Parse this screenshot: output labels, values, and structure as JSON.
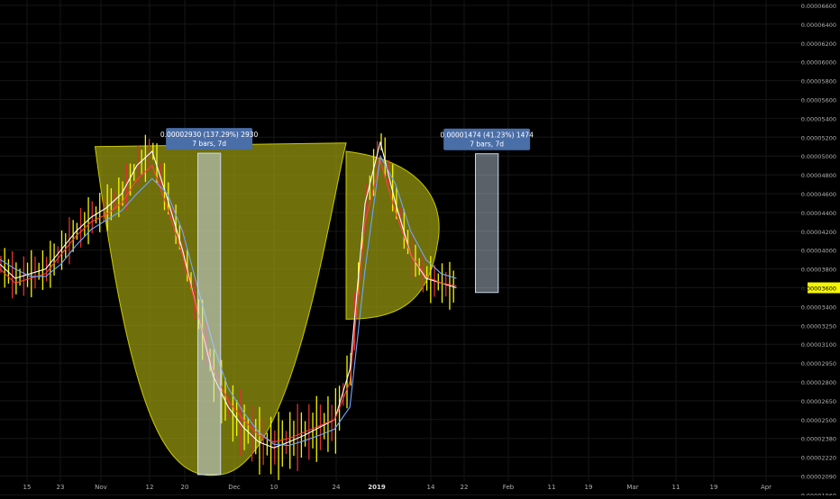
{
  "chart_data": {
    "type": "line",
    "price_axis": {
      "ticks": [
        "0.00006600",
        "0.00006400",
        "0.00006200",
        "0.00006000",
        "0.00005800",
        "0.00005600",
        "0.00005400",
        "0.00005200",
        "0.00005000",
        "0.00004800",
        "0.00004600",
        "0.00004400",
        "0.00004200",
        "0.00004000",
        "0.00003800",
        "0.00003600",
        "0.00003400",
        "0.00003250",
        "0.00003100",
        "0.00002950",
        "0.00002800",
        "0.00002650",
        "0.00002500",
        "0.00002380",
        "0.00002220",
        "0.00002090",
        "0.00001960"
      ],
      "current_price_label": "0.00003600",
      "current_price_color": "#f5f500"
    },
    "time_axis": {
      "ticks": [
        "15",
        "23",
        "Nov",
        "12",
        "20",
        "Dec",
        "10",
        "24",
        "2019",
        "14",
        "22",
        "Feb",
        "11",
        "19",
        "Mar",
        "11",
        "19",
        "Apr"
      ],
      "bold": [
        "2019"
      ]
    },
    "series": [
      {
        "name": "",
        "color": "#ffffff",
        "x": [
          0,
          4,
          8,
          12,
          16,
          20,
          24,
          28,
          32,
          36,
          40,
          44,
          48,
          52,
          56,
          60,
          64,
          68,
          72,
          76,
          80,
          84,
          88,
          92,
          96,
          100,
          104,
          108,
          112,
          116,
          120
        ],
        "y": [
          3850,
          3700,
          3750,
          3800,
          4000,
          4200,
          4350,
          4450,
          4600,
          4900,
          5050,
          4550,
          4000,
          3350,
          2850,
          2600,
          2450,
          2350,
          2300,
          2350,
          2400,
          2450,
          2500,
          2900,
          4500,
          5150,
          4500,
          3950,
          3700,
          3650,
          3600
        ]
      },
      {
        "name": "",
        "color": "#ff4040",
        "x": [
          0,
          4,
          8,
          12,
          16,
          20,
          24,
          28,
          32,
          36,
          40,
          44,
          48,
          52,
          56,
          60,
          64,
          68,
          72,
          76,
          80,
          84,
          88,
          92,
          96,
          100,
          104,
          108,
          112,
          116,
          120
        ],
        "y": [
          3800,
          3650,
          3700,
          3750,
          3950,
          4150,
          4300,
          4380,
          4500,
          4750,
          4900,
          4450,
          3950,
          3350,
          2900,
          2650,
          2500,
          2400,
          2350,
          2380,
          2420,
          2460,
          2500,
          2800,
          4300,
          4950,
          4400,
          3950,
          3720,
          3650,
          3620
        ]
      },
      {
        "name": "",
        "color": "#6fa8ff",
        "x": [
          0,
          4,
          8,
          12,
          16,
          20,
          24,
          28,
          32,
          36,
          40,
          44,
          48,
          52,
          56,
          60,
          64,
          68,
          72,
          76,
          80,
          84,
          88,
          92,
          96,
          100,
          104,
          108,
          112,
          116,
          120
        ],
        "y": [
          3900,
          3800,
          3720,
          3720,
          3850,
          4050,
          4220,
          4320,
          4420,
          4600,
          4760,
          4600,
          4200,
          3600,
          3100,
          2750,
          2560,
          2420,
          2330,
          2320,
          2360,
          2400,
          2440,
          2600,
          3800,
          5000,
          4700,
          4200,
          3900,
          3750,
          3700
        ]
      }
    ],
    "annotations": [
      {
        "label_line1": "0.00002930 (137.29%) 2930",
        "label_line2": "7 bars, 7d",
        "x_start": 52,
        "x_end": 58,
        "y_low": 2100,
        "y_high": 5030
      },
      {
        "label_line1": "0.00001474 (41.23%) 1474",
        "label_line2": "7 bars, 7d",
        "x_start": 125,
        "x_end": 131,
        "y_low": 3550,
        "y_high": 5024
      }
    ],
    "drawings": {
      "cup": {
        "x_left": 25,
        "x_right": 91,
        "x_bottom": 58,
        "y_rim": 5100,
        "y_bottom": 2100
      },
      "handle": {
        "x_left": 91,
        "x_tip": 115,
        "y_top": 5050,
        "y_bottom": 3300
      }
    },
    "bar_colors": {
      "up": "#f5f500",
      "down": "#e03030"
    },
    "grid": true,
    "colors": {
      "background": "#000000",
      "grid": "#161616",
      "axis_text": "#b0b0b0",
      "drawing_fill": "#9a9a10",
      "drawing_stroke": "#c8c800",
      "range_box": "#c8d8e8",
      "label_bg": "#4a6ea8",
      "label_text": "#ffffff"
    }
  }
}
